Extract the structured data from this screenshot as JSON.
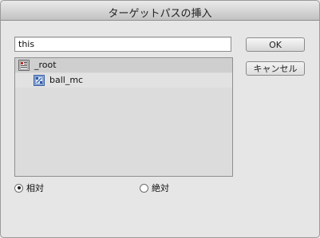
{
  "dialog": {
    "title": "ターゲットパスの挿入"
  },
  "path_field": {
    "value": "this"
  },
  "buttons": {
    "ok_label": "OK",
    "cancel_label": "キャンセル"
  },
  "tree": {
    "root": {
      "label": "_root",
      "icon": "timeline-icon"
    },
    "child": {
      "label": "ball_mc",
      "icon": "movieclip-icon"
    }
  },
  "mode": {
    "relative_label": "相対",
    "absolute_label": "絶対",
    "selected": "相対"
  }
}
